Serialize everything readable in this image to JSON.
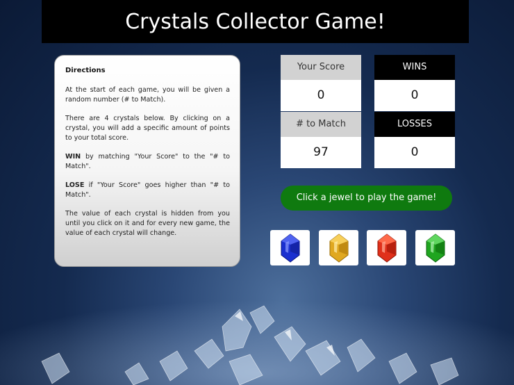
{
  "header": {
    "title": "Crystals Collector Game!"
  },
  "directions": {
    "heading": "Directions",
    "p1": "At the start of each game, you will be given a random number (# to Match).",
    "p2": "There are 4 crystals below. By clicking on a crystal, you will add a specific amount of points to your total score.",
    "p3_strong": "WIN",
    "p3_rest": " by matching \"Your Score\" to the \"# to Match\".",
    "p4_strong": "LOSE",
    "p4_rest": " if \"Your Score\" goes higher than \"# to Match\".",
    "p5": "The value of each crystal is hidden from you until you click on it and for every new game, the value of each crystal will change."
  },
  "scoreboard": {
    "your_score_label": "Your Score",
    "your_score_value": "0",
    "to_match_label": "# to Match",
    "to_match_value": "97",
    "wins_label": "WINS",
    "wins_value": "0",
    "losses_label": "LOSSES",
    "losses_value": "0"
  },
  "play_button_label": "Click a jewel to play the game!",
  "crystals": [
    {
      "icon": "blue-crystal-icon",
      "color": "#1a2fd0"
    },
    {
      "icon": "yellow-crystal-icon",
      "color": "#e0a820"
    },
    {
      "icon": "red-crystal-icon",
      "color": "#e0301a"
    },
    {
      "icon": "green-crystal-icon",
      "color": "#1fa51f"
    }
  ],
  "colors": {
    "play_button": "#0f7a0f",
    "title_bar": "#000000"
  }
}
